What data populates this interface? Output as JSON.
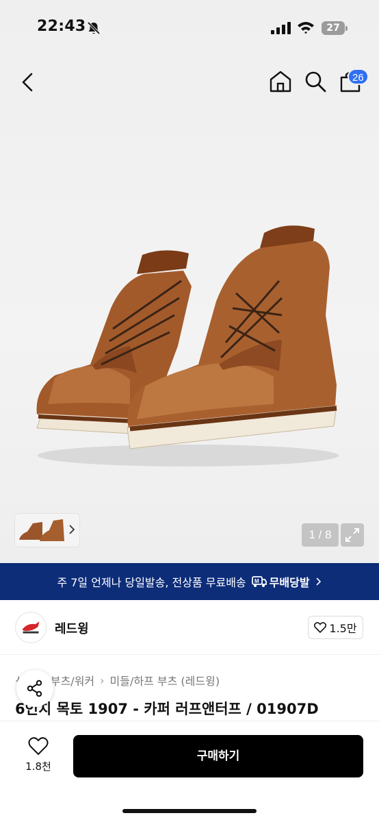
{
  "status_bar": {
    "time": "22:43",
    "battery": "27"
  },
  "nav": {
    "cart_badge": "26"
  },
  "gallery": {
    "counter": "1 / 8"
  },
  "shipping_banner": {
    "text": "주 7일 언제나 당일발송, 전상품 무료배송",
    "logo": "무배당발"
  },
  "brand": {
    "name": "레드윙",
    "likes": "1.5만"
  },
  "breadcrumb": [
    "부츠/워커",
    "미들/하프 부츠 (레드윙)"
  ],
  "breadcrumb_hidden_prefix": "신발",
  "product": {
    "title": "6인치 목토 1907 - 카퍼 러프앤터프 / 01907D"
  },
  "bottom_bar": {
    "wish_count": "1.8천",
    "buy_label": "구매하기"
  },
  "icons": {
    "back": "chevron-left-icon",
    "home": "home-icon",
    "search": "search-icon",
    "cart": "cart-icon",
    "share": "share-icon",
    "heart": "heart-icon",
    "expand": "expand-icon",
    "bell_off": "bell-off-icon"
  },
  "colors": {
    "banner": "#0d2d79",
    "badge": "#2f6ff2",
    "buy_button": "#000000",
    "leather": "#a9602f"
  }
}
